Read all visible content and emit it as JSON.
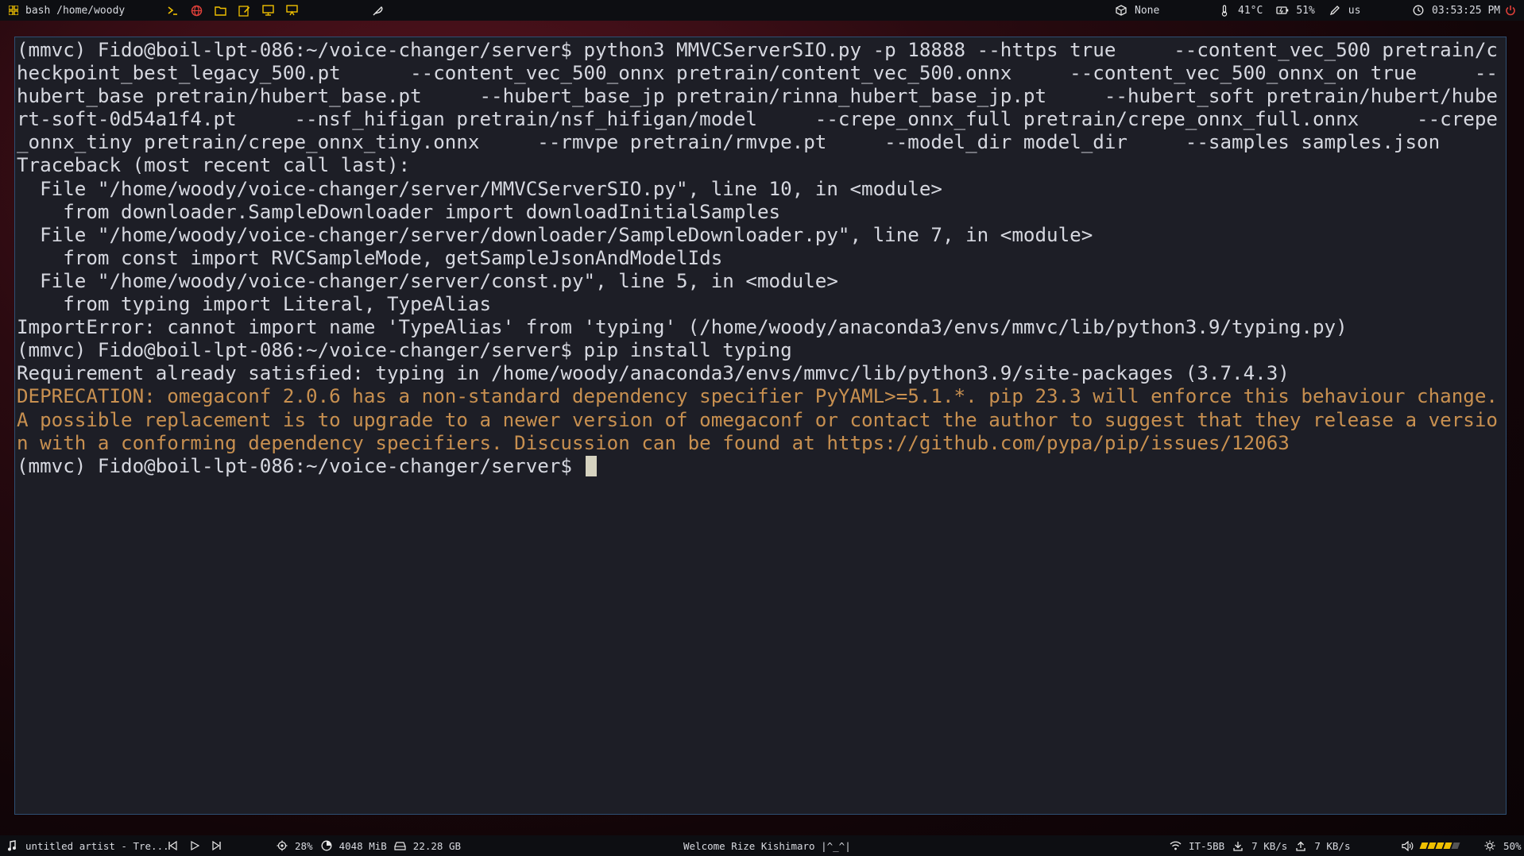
{
  "topbar": {
    "window_title": "bash /home/woody",
    "launchers": [
      "terminal-icon",
      "browser-icon",
      "folder-icon",
      "editor-icon",
      "monitor-icon",
      "display-icon"
    ],
    "pen_icon": "feather-icon",
    "package_label": "None",
    "temperature": "41°C",
    "battery": "51%",
    "keyboard_layout": "us",
    "clock": "03:53:25 PM"
  },
  "terminal": {
    "lines": [
      {
        "text": "(mmvc) Fido@boil-lpt-086:~/voice-changer/server$ python3 MMVCServerSIO.py -p 18888 --https true     --content_vec_500 pretrain/checkpoint_best_legacy_500.pt      --content_vec_500_onnx pretrain/content_vec_500.onnx     --content_vec_500_onnx_on true     --hubert_base pretrain/hubert_base.pt     --hubert_base_jp pretrain/rinna_hubert_base_jp.pt     --hubert_soft pretrain/hubert/hubert-soft-0d54a1f4.pt     --nsf_hifigan pretrain/nsf_hifigan/model     --crepe_onnx_full pretrain/crepe_onnx_full.onnx     --crepe_onnx_tiny pretrain/crepe_onnx_tiny.onnx     --rmvpe pretrain/rmvpe.pt     --model_dir model_dir     --samples samples.json",
        "type": "normal"
      },
      {
        "text": "Traceback (most recent call last):",
        "type": "normal"
      },
      {
        "text": "  File \"/home/woody/voice-changer/server/MMVCServerSIO.py\", line 10, in <module>",
        "type": "normal"
      },
      {
        "text": "    from downloader.SampleDownloader import downloadInitialSamples",
        "type": "normal"
      },
      {
        "text": "  File \"/home/woody/voice-changer/server/downloader/SampleDownloader.py\", line 7, in <module>",
        "type": "normal"
      },
      {
        "text": "    from const import RVCSampleMode, getSampleJsonAndModelIds",
        "type": "normal"
      },
      {
        "text": "  File \"/home/woody/voice-changer/server/const.py\", line 5, in <module>",
        "type": "normal"
      },
      {
        "text": "    from typing import Literal, TypeAlias",
        "type": "normal"
      },
      {
        "text": "ImportError: cannot import name 'TypeAlias' from 'typing' (/home/woody/anaconda3/envs/mmvc/lib/python3.9/typing.py)",
        "type": "normal"
      },
      {
        "text": "(mmvc) Fido@boil-lpt-086:~/voice-changer/server$ pip install typing",
        "type": "normal"
      },
      {
        "text": "Requirement already satisfied: typing in /home/woody/anaconda3/envs/mmvc/lib/python3.9/site-packages (3.7.4.3)",
        "type": "normal"
      },
      {
        "text": "DEPRECATION: omegaconf 2.0.6 has a non-standard dependency specifier PyYAML>=5.1.*. pip 23.3 will enforce this behaviour change. A possible replacement is to upgrade to a newer version of omegaconf or contact the author to suggest that they release a version with a conforming dependency specifiers. Discussion can be found at https://github.com/pypa/pip/issues/12063",
        "type": "warn"
      }
    ],
    "prompt": "(mmvc) Fido@boil-lpt-086:~/voice-changer/server$ "
  },
  "bottombar": {
    "now_playing": "untitled artist - Tre...",
    "cpu": "28%",
    "memory": "4048 MiB",
    "disk": "22.28 GB",
    "welcome": "Welcome Rize Kishimaro |^_^|",
    "wifi": "IT-5BB",
    "download": "7 KB/s",
    "upload": "7 KB/s",
    "volume_level": 0.8,
    "brightness": "50%"
  }
}
